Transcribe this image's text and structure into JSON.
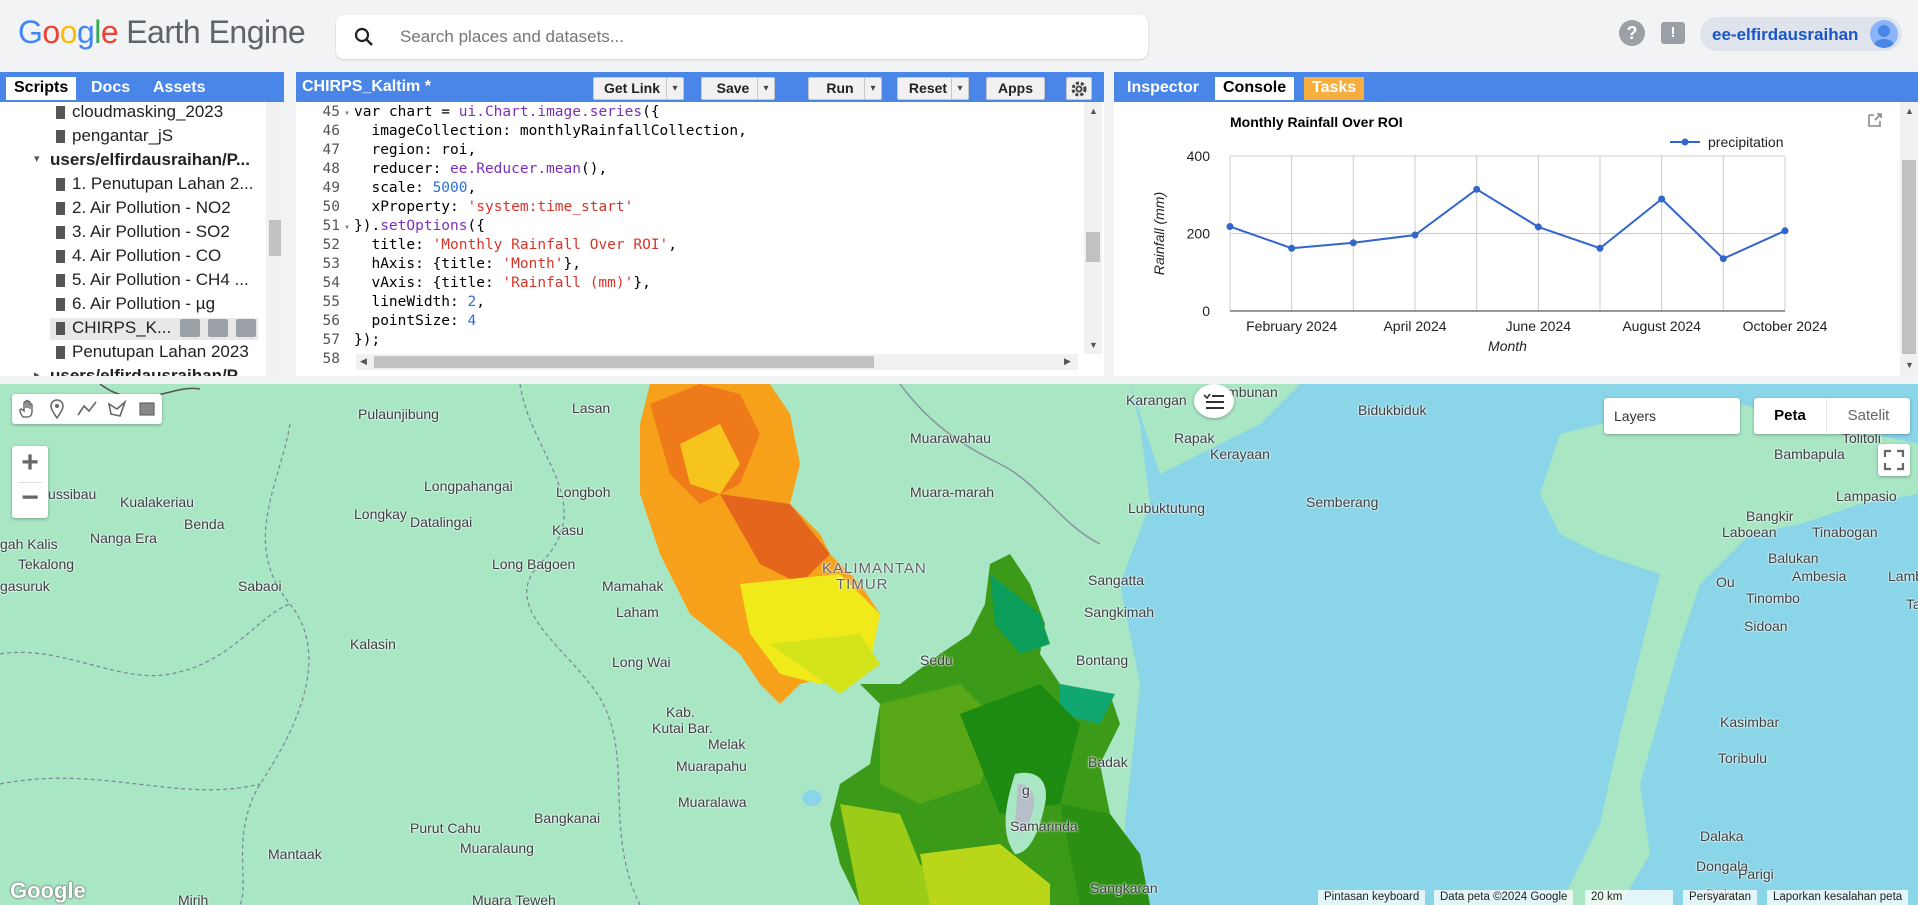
{
  "header": {
    "logo_google": "Google",
    "logo_product": "Earth Engine",
    "search_placeholder": "Search places and datasets...",
    "help_icon": "help-icon",
    "feedback_icon": "feedback-icon",
    "username": "ee-elfirdausraihan"
  },
  "left_panel": {
    "tabs": [
      "Scripts",
      "Docs",
      "Assets"
    ],
    "active_tab": "Scripts",
    "tree": [
      {
        "label": "cloudmasking_2023",
        "type": "file",
        "indent": 2
      },
      {
        "label": "pengantar_jS",
        "type": "file",
        "indent": 2
      },
      {
        "label": "users/elfirdausraihan/P...",
        "type": "folder-open",
        "indent": 1
      },
      {
        "label": "1. Penutupan Lahan 2...",
        "type": "file",
        "indent": 2
      },
      {
        "label": "2. Air Pollution - NO2",
        "type": "file",
        "indent": 2
      },
      {
        "label": "3. Air Pollution - SO2",
        "type": "file",
        "indent": 2
      },
      {
        "label": "4. Air Pollution - CO",
        "type": "file",
        "indent": 2
      },
      {
        "label": "5. Air Pollution - CH4 ...",
        "type": "file",
        "indent": 2
      },
      {
        "label": "6. Air Pollution - µg",
        "type": "file",
        "indent": 2
      },
      {
        "label": "CHIRPS_K...",
        "type": "file-selected",
        "indent": 2
      },
      {
        "label": "Penutupan Lahan 2023",
        "type": "file",
        "indent": 2
      },
      {
        "label": "users/elfirdausraihan/P...",
        "type": "folder-closed",
        "indent": 1
      }
    ]
  },
  "editor": {
    "script_name": "CHIRPS_Kaltim *",
    "buttons": {
      "get_link": "Get Link",
      "save": "Save",
      "run": "Run",
      "reset": "Reset",
      "apps": "Apps"
    },
    "lines": [
      {
        "n": "45",
        "fold": "▾",
        "code": [
          [
            "kw",
            "var chart = "
          ],
          [
            "fn",
            "ui.Chart.image.series"
          ],
          [
            "kw",
            "({"
          ]
        ]
      },
      {
        "n": "46",
        "fold": "",
        "code": [
          [
            "kw",
            "  imageCollection: monthlyRainfallCollection,"
          ]
        ]
      },
      {
        "n": "47",
        "fold": "",
        "code": [
          [
            "kw",
            "  region: roi,"
          ]
        ]
      },
      {
        "n": "48",
        "fold": "",
        "code": [
          [
            "kw",
            "  reducer: "
          ],
          [
            "fn",
            "ee.Reducer.mean"
          ],
          [
            "kw",
            "(),"
          ]
        ]
      },
      {
        "n": "49",
        "fold": "",
        "code": [
          [
            "kw",
            "  scale: "
          ],
          [
            "num",
            "5000"
          ],
          [
            "kw",
            ","
          ]
        ]
      },
      {
        "n": "50",
        "fold": "",
        "code": [
          [
            "kw",
            "  xProperty: "
          ],
          [
            "str",
            "'system:time_start'"
          ]
        ]
      },
      {
        "n": "51",
        "fold": "▾",
        "code": [
          [
            "kw",
            "})."
          ],
          [
            "fn",
            "setOptions"
          ],
          [
            "kw",
            "({"
          ]
        ]
      },
      {
        "n": "52",
        "fold": "",
        "code": [
          [
            "kw",
            "  title: "
          ],
          [
            "str",
            "'Monthly Rainfall Over ROI'"
          ],
          [
            "kw",
            ","
          ]
        ]
      },
      {
        "n": "53",
        "fold": "",
        "code": [
          [
            "kw",
            "  hAxis: {title: "
          ],
          [
            "str",
            "'Month'"
          ],
          [
            "kw",
            "},"
          ]
        ]
      },
      {
        "n": "54",
        "fold": "",
        "code": [
          [
            "kw",
            "  vAxis: {title: "
          ],
          [
            "str",
            "'Rainfall (mm)'"
          ],
          [
            "kw",
            "},"
          ]
        ]
      },
      {
        "n": "55",
        "fold": "",
        "code": [
          [
            "kw",
            "  lineWidth: "
          ],
          [
            "num",
            "2"
          ],
          [
            "kw",
            ","
          ]
        ]
      },
      {
        "n": "56",
        "fold": "",
        "code": [
          [
            "kw",
            "  pointSize: "
          ],
          [
            "num",
            "4"
          ]
        ]
      },
      {
        "n": "57",
        "fold": "",
        "code": [
          [
            "kw",
            "});"
          ]
        ]
      },
      {
        "n": "58",
        "fold": "",
        "code": [
          [
            "kw",
            ""
          ]
        ]
      }
    ]
  },
  "right_panel": {
    "tabs": [
      "Inspector",
      "Console",
      "Tasks"
    ],
    "active_tab": "Console",
    "tasks_color": "#f6ae3e"
  },
  "chart_data": {
    "type": "line",
    "title": "Monthly Rainfall Over ROI",
    "xlabel": "Month",
    "ylabel": "Rainfall (mm)",
    "legend": "top-right",
    "series": [
      {
        "name": "precipitation",
        "values": [
          218,
          162,
          176,
          196,
          314,
          217,
          162,
          289,
          135,
          207
        ]
      }
    ],
    "x": [
      "Jan 2024",
      "Feb 2024",
      "Mar 2024",
      "Apr 2024",
      "May 2024",
      "Jun 2024",
      "Jul 2024",
      "Aug 2024",
      "Sep 2024",
      "Oct 2024"
    ],
    "tick_labels_x": [
      "February 2024",
      "April 2024",
      "June 2024",
      "August 2024",
      "October 2024"
    ],
    "tick_labels_y": [
      "400",
      "200",
      "0"
    ],
    "ylim": [
      0,
      400
    ],
    "grid": true,
    "line_color": "#3366cc"
  },
  "map": {
    "layers_label": "Layers",
    "maptype_buttons": [
      "Peta",
      "Satelit"
    ],
    "active_maptype": "Peta",
    "places": [
      "Timbunan",
      "Lasan",
      "Pulaunjibung",
      "Karangan",
      "Bidukbiduk",
      "Muarawahau",
      "Rapak",
      "Kerayaan",
      "Tolitoli",
      "Bambapula",
      "Muara-marah",
      "Lubuktutung",
      "Semberang",
      "Lampasio",
      "Bangkir",
      "Longpahangai",
      "Longboh",
      "Tussibau",
      "Kualakeriau",
      "Benda",
      "Longkay",
      "Datalingai",
      "Kasu",
      "Laboean",
      "Tinabogan",
      "gah Kalis",
      "Nanga Era",
      "Balukan",
      "Tekalong",
      "Long Bagoen",
      "KALIMANTAN",
      "TIMUR",
      "Sangatta",
      "Ambesia",
      "Lamboe",
      "gasuruk",
      "Sabaoi",
      "Mamahak",
      "Ou",
      "Tinombo",
      "Sangkimah",
      "Laham",
      "Sidoan",
      "Kalasin",
      "Long Wai",
      "Bontang",
      "Sedu",
      "Kab.",
      "Kutai Bar.",
      "Kasimbar",
      "Melak",
      "Toribulu",
      "Muarapahu",
      "Badak",
      "Muaralawa",
      "Bangkanai",
      "Dalaka",
      "Purut Cahu",
      "Muaralaung",
      "Dongala",
      "Mantaak",
      "Parigi",
      "Mirih",
      "Muara Teweh",
      "Samarinda",
      "Sangkaran",
      "Dalu",
      "Ta",
      "g"
    ],
    "attribution": [
      "Pintasan keyboard",
      "Data peta ©2024 Google",
      "20 km",
      "Persyaratan",
      "Laporkan kesalahan peta"
    ],
    "google_mark": "Google"
  }
}
